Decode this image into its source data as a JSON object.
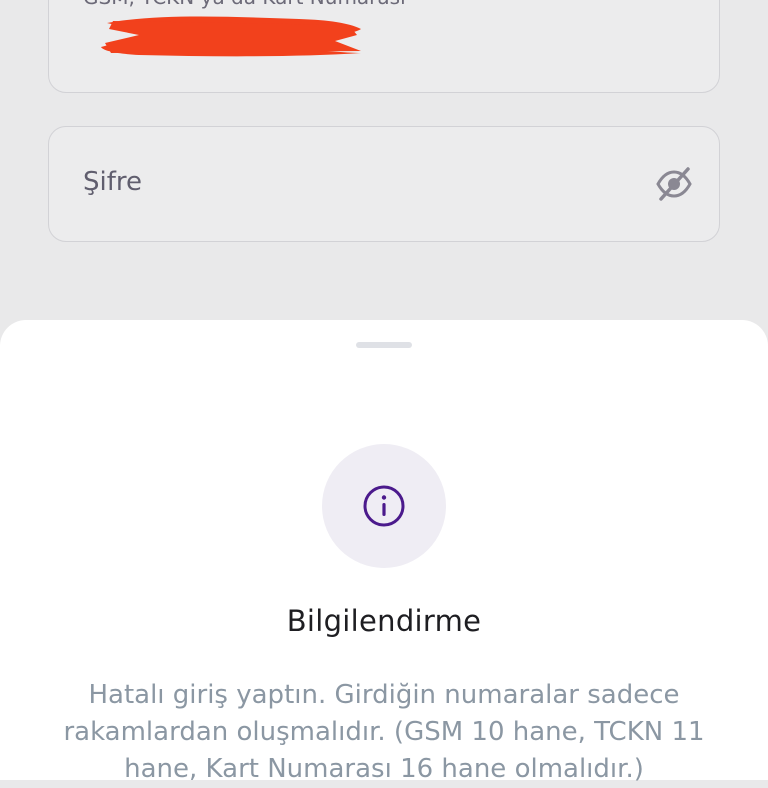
{
  "login": {
    "placeholder": "GSM, TCKN ya da Kart Numarası"
  },
  "password": {
    "label": "Şifre",
    "toggle_icon": "eye-off-icon"
  },
  "sheet": {
    "icon": "info-icon",
    "title": "Bilgilendirme",
    "message_lines": [
      "Hatalı giriş yaptın. Girdiğin numaralar sadece",
      "rakamlardan oluşmalıdır. (GSM  10 hane, TCKN 11",
      "hane, Kart Numarası 16 hane olmalıdır.)"
    ]
  },
  "colors": {
    "accent": "#4b1a8c",
    "redaction": "#f2411c",
    "icon_bg": "#efedf4"
  }
}
